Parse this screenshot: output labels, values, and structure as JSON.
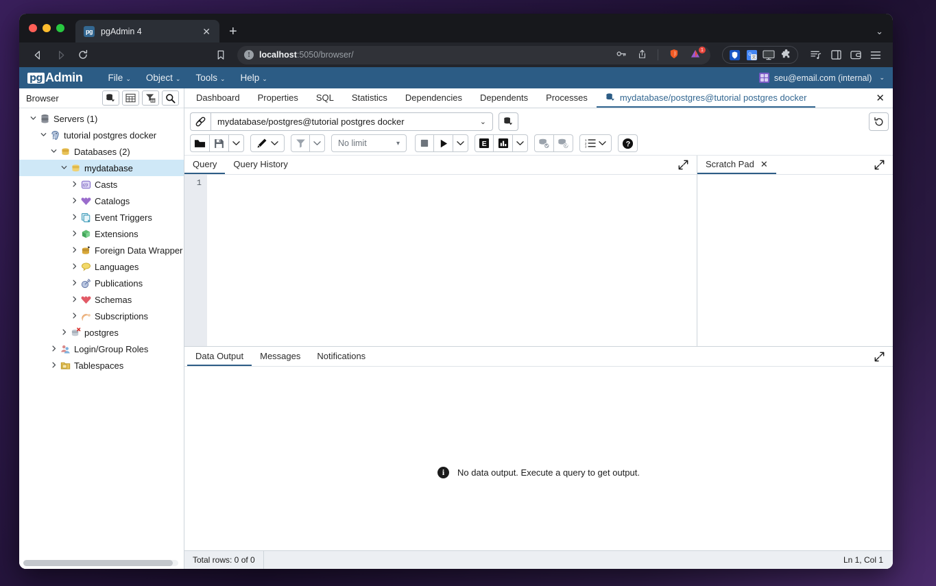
{
  "browser": {
    "tab": {
      "title": "pgAdmin 4",
      "favicon_label": "pg",
      "close_icon": "✕",
      "new_tab_icon": "+"
    },
    "window_controls": [
      "close",
      "minimize",
      "maximize"
    ],
    "nav": {
      "back_icon": "◁",
      "forward_icon": "▷",
      "reload_icon": "⟳",
      "bookmark_icon": "🔖"
    },
    "omnibox": {
      "info_icon": "!",
      "url_host": "localhost",
      "url_path": ":5050/browser/",
      "full_url": "localhost:5050/browser/",
      "key_icon": "key-icon",
      "share_icon": "share-icon",
      "brave_icon": "brave-shield-icon",
      "notification_badge": "1"
    },
    "extensions": [
      "shield-icon",
      "translate-icon",
      "display-icon",
      "puzzle-icon"
    ],
    "toolbar_icons": [
      "reading-list-icon",
      "sidebar-icon",
      "wallet-icon",
      "menu-icon"
    ],
    "tabstrip_right_icon": "⌄"
  },
  "pgadmin": {
    "logo": {
      "mark": "pg",
      "word": "Admin"
    },
    "menus": [
      "File",
      "Object",
      "Tools",
      "Help"
    ],
    "user": {
      "label": "seu@email.com (internal)",
      "caret": "⌄"
    }
  },
  "sidebar": {
    "title": "Browser",
    "buttons": [
      "object-explorer-icon",
      "grid-icon",
      "filter-icon",
      "search-icon"
    ],
    "tree": [
      {
        "label": "Servers (1)",
        "depth": 0,
        "arrow": "down",
        "icon": "servers-icon",
        "selected": false
      },
      {
        "label": "tutorial postgres docker",
        "depth": 1,
        "arrow": "down",
        "icon": "postgres-elephant-icon",
        "selected": false
      },
      {
        "label": "Databases (2)",
        "depth": 2,
        "arrow": "down",
        "icon": "databases-icon",
        "selected": false
      },
      {
        "label": "mydatabase",
        "depth": 3,
        "arrow": "down",
        "icon": "database-icon",
        "selected": true
      },
      {
        "label": "Casts",
        "depth": 4,
        "arrow": "right",
        "icon": "casts-icon",
        "selected": false
      },
      {
        "label": "Catalogs",
        "depth": 4,
        "arrow": "right",
        "icon": "catalogs-icon",
        "selected": false
      },
      {
        "label": "Event Triggers",
        "depth": 4,
        "arrow": "right",
        "icon": "event-triggers-icon",
        "selected": false
      },
      {
        "label": "Extensions",
        "depth": 4,
        "arrow": "right",
        "icon": "extensions-icon",
        "selected": false
      },
      {
        "label": "Foreign Data Wrapper",
        "depth": 4,
        "arrow": "right",
        "icon": "foreign-data-wrapper-icon",
        "selected": false
      },
      {
        "label": "Languages",
        "depth": 4,
        "arrow": "right",
        "icon": "languages-icon",
        "selected": false
      },
      {
        "label": "Publications",
        "depth": 4,
        "arrow": "right",
        "icon": "publications-icon",
        "selected": false
      },
      {
        "label": "Schemas",
        "depth": 4,
        "arrow": "right",
        "icon": "schemas-icon",
        "selected": false
      },
      {
        "label": "Subscriptions",
        "depth": 4,
        "arrow": "right",
        "icon": "subscriptions-icon",
        "selected": false
      },
      {
        "label": "postgres",
        "depth": 3,
        "arrow": "right",
        "icon": "database-disconnected-icon",
        "selected": false
      },
      {
        "label": "Login/Group Roles",
        "depth": 2,
        "arrow": "right",
        "icon": "roles-icon",
        "selected": false
      },
      {
        "label": "Tablespaces",
        "depth": 2,
        "arrow": "right",
        "icon": "tablespaces-icon",
        "selected": false
      }
    ]
  },
  "content_tabs": {
    "items": [
      {
        "label": "Dashboard",
        "active": false,
        "icon": null
      },
      {
        "label": "Properties",
        "active": false,
        "icon": null
      },
      {
        "label": "SQL",
        "active": false,
        "icon": null
      },
      {
        "label": "Statistics",
        "active": false,
        "icon": null
      },
      {
        "label": "Dependencies",
        "active": false,
        "icon": null
      },
      {
        "label": "Dependents",
        "active": false,
        "icon": null
      },
      {
        "label": "Processes",
        "active": false,
        "icon": null
      },
      {
        "label": "mydatabase/postgres@tutorial postgres docker",
        "active": true,
        "icon": "query-tool-icon"
      }
    ],
    "close_icon": "✕"
  },
  "connection_bar": {
    "connect_icon": "connection-icon",
    "value": "mydatabase/postgres@tutorial postgres docker",
    "caret": "⌄",
    "new_connection_icon": "new-connection-icon",
    "reset_icon": "reset-layout-icon"
  },
  "query_toolbar": {
    "groups": [
      {
        "buttons": [
          {
            "name": "open-file-button",
            "icon": "folder-icon",
            "type": "icon"
          },
          {
            "name": "save-file-button",
            "icon": "save-icon",
            "type": "icon"
          },
          {
            "name": "save-file-dropdown",
            "icon": "chevron-down-icon",
            "type": "caret"
          }
        ]
      },
      {
        "buttons": [
          {
            "name": "edit-button",
            "icon": "pencil-icon",
            "type": "icon-caret"
          }
        ]
      },
      {
        "buttons": [
          {
            "name": "filter-button",
            "icon": "filter-icon",
            "type": "icon"
          },
          {
            "name": "filter-dropdown",
            "icon": "chevron-down-icon",
            "type": "caret"
          }
        ]
      }
    ],
    "row_limit": {
      "label": "No limit",
      "caret": "▾"
    },
    "groups2": [
      {
        "buttons": [
          {
            "name": "stop-query-button",
            "icon": "stop-icon",
            "type": "icon"
          },
          {
            "name": "execute-query-button",
            "icon": "play-icon",
            "type": "icon"
          },
          {
            "name": "execute-dropdown",
            "icon": "chevron-down-icon",
            "type": "caret"
          }
        ]
      },
      {
        "buttons": [
          {
            "name": "explain-button",
            "icon": "explain-E-icon",
            "type": "icon"
          },
          {
            "name": "explain-analyze-button",
            "icon": "explain-analyze-icon",
            "type": "icon"
          },
          {
            "name": "explain-dropdown",
            "icon": "chevron-down-icon",
            "type": "caret"
          }
        ]
      },
      {
        "buttons": [
          {
            "name": "commit-button",
            "icon": "commit-icon",
            "type": "icon"
          },
          {
            "name": "rollback-button",
            "icon": "rollback-icon",
            "type": "icon"
          }
        ]
      },
      {
        "buttons": [
          {
            "name": "macros-button",
            "icon": "list-icon",
            "type": "icon-caret"
          }
        ]
      },
      {
        "buttons": [
          {
            "name": "help-button",
            "icon": "help-icon",
            "type": "icon"
          }
        ]
      }
    ]
  },
  "query_panel": {
    "tabs": [
      {
        "label": "Query",
        "active": true
      },
      {
        "label": "Query History",
        "active": false
      }
    ],
    "expand_icon": "expand-icon",
    "line_numbers": [
      "1"
    ],
    "code": ""
  },
  "scratch_pad": {
    "tab_label": "Scratch Pad",
    "close_icon": "✕",
    "expand_icon": "expand-icon",
    "content": ""
  },
  "output_panel": {
    "tabs": [
      {
        "label": "Data Output",
        "active": true
      },
      {
        "label": "Messages",
        "active": false
      },
      {
        "label": "Notifications",
        "active": false
      }
    ],
    "expand_icon": "expand-icon",
    "empty_message": "No data output. Execute a query to get output.",
    "info_icon": "i"
  },
  "statusbar": {
    "total_rows": "Total rows: 0 of 0",
    "cursor_position": "Ln 1, Col 1"
  },
  "colors": {
    "pg_header": "#2c5c85",
    "accent": "#336791",
    "tree_selected": "#cfe8f7",
    "browser_chrome": "#23252b"
  }
}
